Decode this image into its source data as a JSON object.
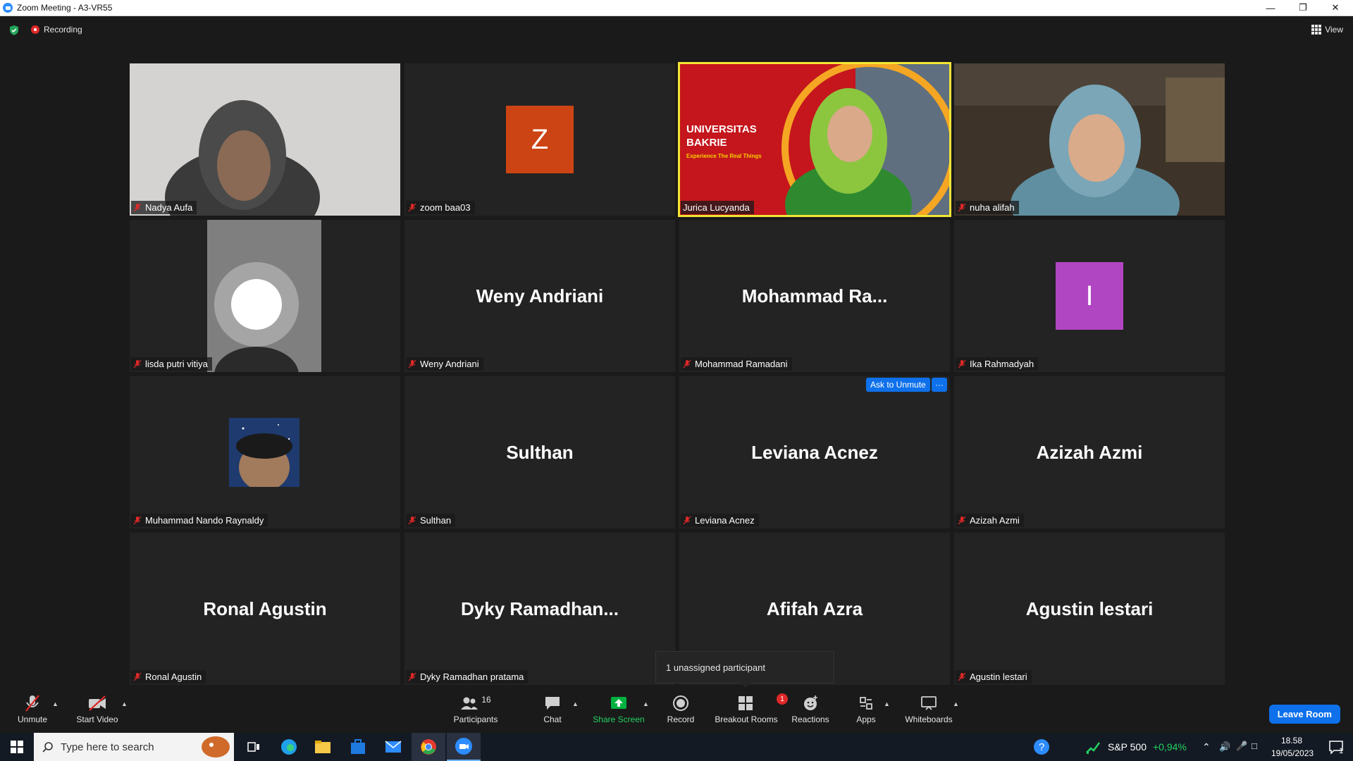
{
  "window": {
    "title": "Zoom Meeting - A3-VR55"
  },
  "meeting": {
    "recording_label": "Recording",
    "view_label": "View"
  },
  "tiles": [
    {
      "label": "Nadya Aufa",
      "kind": "video"
    },
    {
      "label": "zoom baa03",
      "avatar_letter": "Z",
      "avatar_color": "#cc4413"
    },
    {
      "label": "Jurica Lucyanda",
      "kind": "video",
      "overlay": {
        "line1": "UNIVERSITAS",
        "line2": "BAKRIE",
        "tagline": "Experience The Real Things"
      }
    },
    {
      "label": "nuha alifah",
      "kind": "video"
    },
    {
      "label": "lisda putri vitiya",
      "kind": "video"
    },
    {
      "label": "Weny Andriani",
      "big": "Weny Andriani"
    },
    {
      "label": "Mohammad Ramadani",
      "big": "Mohammad  Ra..."
    },
    {
      "label": "Ika Rahmadyah",
      "avatar_letter": "I",
      "avatar_color": "#b146c2"
    },
    {
      "label": "Muhammad Nando Raynaldy",
      "kind": "photo"
    },
    {
      "label": "Sulthan",
      "big": "Sulthan"
    },
    {
      "label": "Leviana Acnez",
      "big": "Leviana Acnez"
    },
    {
      "label": "Azizah Azmi",
      "big": "Azizah Azmi"
    },
    {
      "label": "Ronal Agustin",
      "big": "Ronal Agustin"
    },
    {
      "label": "Dyky Ramadhan pratama",
      "big": "Dyky  Ramadhan..."
    },
    {
      "label": "",
      "big": "Afifah Azra"
    },
    {
      "label": "Agustin lestari",
      "big": "Agustin lestari"
    }
  ],
  "hover_actions": {
    "ask_to_unmute": "Ask to Unmute",
    "more": "···"
  },
  "popup": {
    "text": "1 unassigned participant"
  },
  "toolbar": {
    "unmute": "Unmute",
    "start_video": "Start Video",
    "participants": "Participants",
    "participants_count": "16",
    "chat": "Chat",
    "share_screen": "Share Screen",
    "record": "Record",
    "breakout_rooms": "Breakout Rooms",
    "breakout_badge": "1",
    "reactions": "Reactions",
    "apps": "Apps",
    "whiteboards": "Whiteboards",
    "leave": "Leave Room"
  },
  "taskbar": {
    "search_placeholder": "Type here to search",
    "stock_name": "S&P 500",
    "stock_change": "+0,94%",
    "time": "18.58",
    "date": "19/05/2023",
    "notifications": "1"
  },
  "colors": {
    "accent": "#0e71eb",
    "active_speaker": "#f3e535",
    "share_green": "#00b140",
    "mute_red": "#e02828"
  }
}
